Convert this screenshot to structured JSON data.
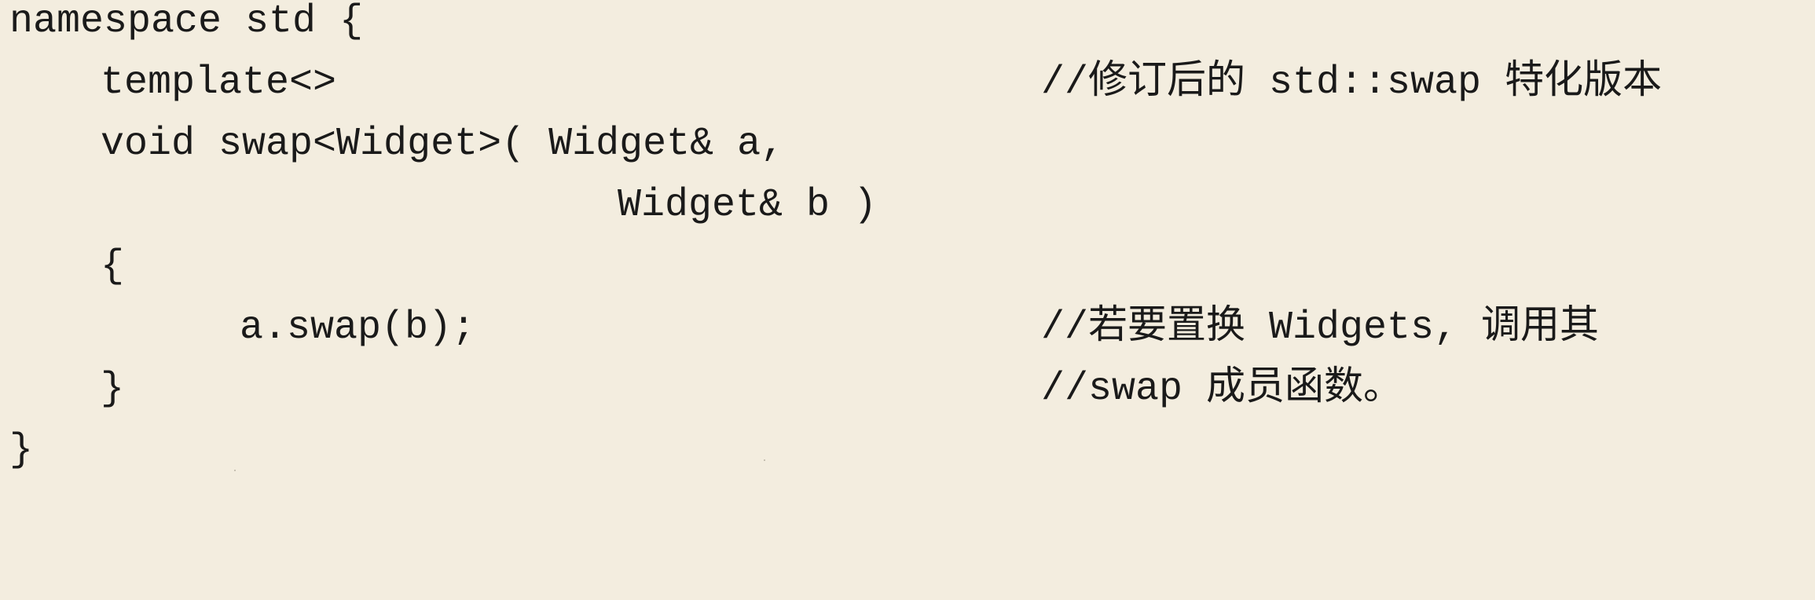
{
  "code": {
    "lines": [
      {
        "code": "namespace std {",
        "comment": ""
      },
      {
        "code": "template<>",
        "comment": "//修订后的 std::swap 特化版本"
      },
      {
        "code": "void swap<Widget>( Widget& a,",
        "comment": ""
      },
      {
        "code": "Widget& b )",
        "comment": ""
      },
      {
        "code": "{",
        "comment": ""
      },
      {
        "code": "a.swap(b);",
        "comment": "//若要置换 Widgets, 调用其"
      },
      {
        "code": "}",
        "comment": "//swap 成员函数。"
      },
      {
        "code": "}",
        "comment": ""
      }
    ]
  }
}
